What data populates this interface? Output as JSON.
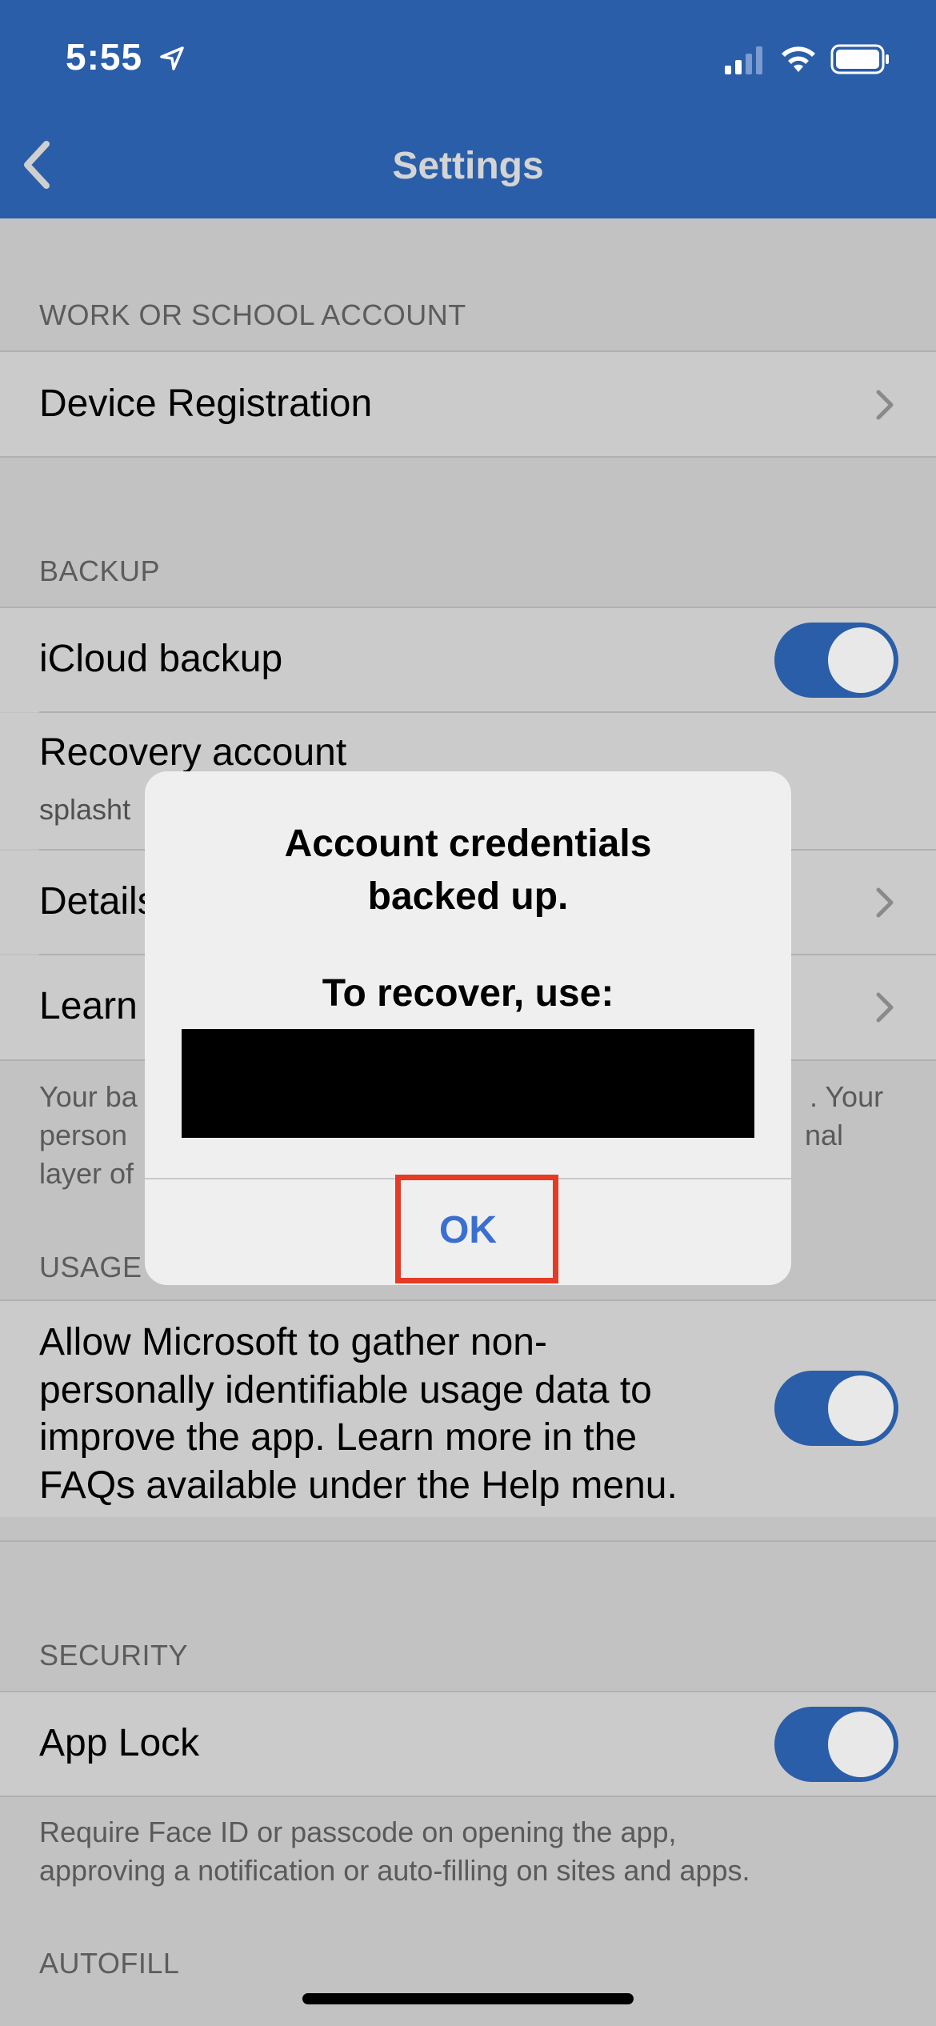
{
  "status_bar": {
    "time": "5:55"
  },
  "header": {
    "title": "Settings"
  },
  "sections": {
    "work": {
      "header": "WORK OR SCHOOL ACCOUNT",
      "device_registration": "Device Registration"
    },
    "backup": {
      "header": "BACKUP",
      "icloud_backup": "iCloud backup",
      "recovery_account": "Recovery account",
      "recovery_account_sub": "splasht",
      "details": "Details",
      "learn": "Learn",
      "footer_line1_left": "Your ba",
      "footer_line1_right": ". Your",
      "footer_line2_left": "person",
      "footer_line2_right": "nal",
      "footer_line3_left": "layer of"
    },
    "usage": {
      "header": "USAGE",
      "text_line1": "Allow Microsoft to gather non-",
      "text_line2": "personally identifiable usage data to",
      "text_line3": "improve the app. Learn more in the",
      "text_line4": "FAQs available under the Help menu."
    },
    "security": {
      "header": "SECURITY",
      "app_lock": "App Lock",
      "footer_line1": "Require Face ID or passcode on opening the app,",
      "footer_line2": "approving a notification or auto-filling on sites and apps."
    },
    "autofill": {
      "header": "AUTOFILL"
    }
  },
  "dialog": {
    "title_line1": "Account credentials",
    "title_line2": "backed up.",
    "recover_label": "To recover, use:",
    "ok_label": "OK"
  },
  "colors": {
    "header_bg": "#2a5ea8",
    "toggle_on": "#2a5ea8",
    "ok_text": "#3a6fd0",
    "highlight": "#e53a25"
  }
}
